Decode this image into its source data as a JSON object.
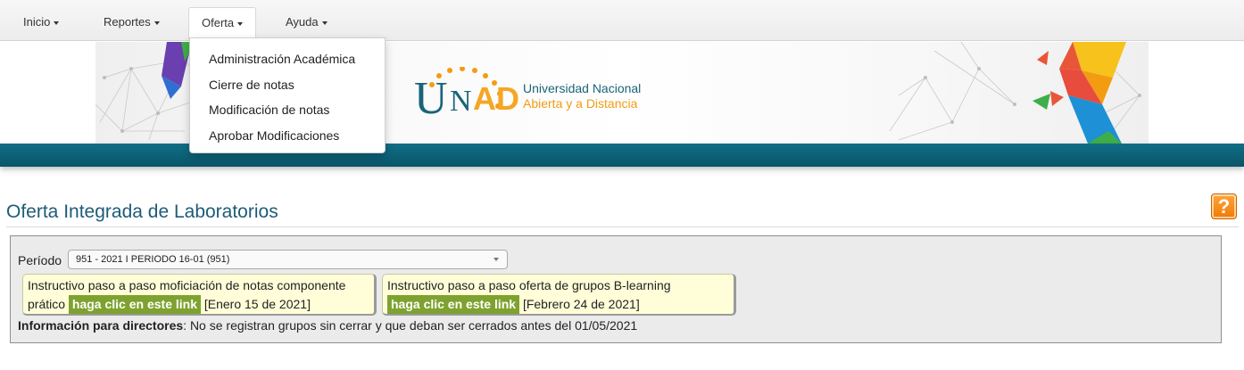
{
  "nav": {
    "items": [
      {
        "label": "Inicio"
      },
      {
        "label": "Reportes"
      },
      {
        "label": "Oferta"
      },
      {
        "label": "Ayuda"
      }
    ]
  },
  "dropdown": {
    "items": [
      {
        "label": "Administración Académica"
      },
      {
        "label": "Cierre de notas"
      },
      {
        "label": "Modificación de notas"
      },
      {
        "label": "Aprobar Modificaciones"
      }
    ]
  },
  "logo": {
    "u": "U",
    "n": "N",
    "ad": "AD",
    "line1": "Universidad Nacional",
    "line2": "Abierta y a Distancia"
  },
  "page": {
    "title": "Oferta Integrada de Laboratorios",
    "help": "?"
  },
  "form": {
    "periodo_label": "Período",
    "periodo_value": "951 - 2021 I PERIODO 16-01 (951)"
  },
  "notes": [
    {
      "text": "Instructivo paso a paso moficiación de notas componente",
      "text2": "prático",
      "link": "haga clic en este link",
      "date": "[Enero 15 de 2021]"
    },
    {
      "text": "Instructivo paso a paso oferta de grupos B-learning",
      "link": "haga clic en este link",
      "date": "[Febrero 24 de 2021]"
    }
  ],
  "info": {
    "label": "Información para directores",
    "text": ": No se registran grupos sin cerrar y que deban ser cerrados antes del 01/05/2021"
  },
  "colors": {
    "brand_teal": "#1a6479",
    "brand_orange": "#f5a623",
    "link_green": "#7ea22f",
    "title_blue": "#1e5b76"
  }
}
